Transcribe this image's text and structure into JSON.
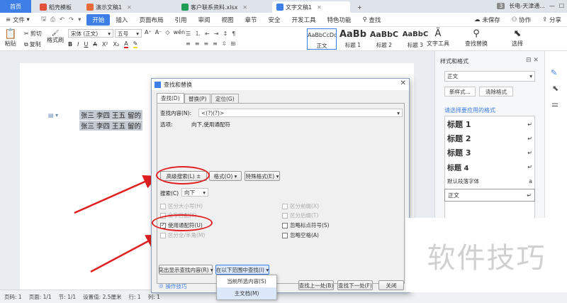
{
  "tabs": {
    "home": "首页",
    "items": [
      {
        "label": "稻壳模板",
        "color": "#e0533a"
      },
      {
        "label": "演示文稿1",
        "color": "#e86a3a"
      },
      {
        "label": "客户联系资料.xlsx",
        "color": "#1f9d55"
      },
      {
        "label": "文字文稿1",
        "color": "#3d7fe6"
      }
    ],
    "badge": "3",
    "user": "长电-天津通..."
  },
  "menu": {
    "file": "文件",
    "items": [
      "开始",
      "插入",
      "页面布局",
      "引用",
      "审阅",
      "视图",
      "章节",
      "安全",
      "开发工具",
      "特色功能"
    ],
    "search": "查找",
    "unsaved": "未保存",
    "collab": "协作",
    "share": "分享"
  },
  "ribbon": {
    "paste": "粘贴",
    "cut": "剪切",
    "copy": "复制",
    "format_painter": "格式刷",
    "font_name": "宋体 (正文)",
    "font_size": "五号",
    "styles": [
      {
        "preview": "AaBbCcDd",
        "label": "正文"
      },
      {
        "preview": "AaBb",
        "label": "标题 1"
      },
      {
        "preview": "AaBbC",
        "label": "标题 2"
      },
      {
        "preview": "AaBbC",
        "label": "标题 3"
      }
    ],
    "text_tools": "文字工具",
    "find_replace": "查找替换",
    "select": "选择"
  },
  "document": {
    "line1": "张三  李四  王五  留的",
    "line2": "张三  李四  王五  留的"
  },
  "panel": {
    "title": "样式和格式",
    "current_style": "正文",
    "new_style": "新样式...",
    "clear_format": "清除格式",
    "apply_label": "请选择要应用的格式",
    "styles": [
      "标题 1",
      "标题 2",
      "标题 3",
      "标题 4"
    ],
    "default_font": "默认段落字体",
    "body": "正文"
  },
  "status": {
    "page": "页码: 1",
    "pages": "页面: 1/1",
    "section": "节: 1/1",
    "setting": "设置值: 2.5厘米",
    "row": "行: 1",
    "col": "列: 1"
  },
  "dialog": {
    "title": "查找和替换",
    "tabs": [
      "查找(D)",
      "替换(P)",
      "定位(G)"
    ],
    "find_label": "查找内容(N):",
    "find_value": "<(?)(?)>",
    "options_label": "选项:",
    "options_value": "向下,使用通配符",
    "advanced": "高级搜索(L) ±",
    "format": "格式(O) ▾",
    "special": "特殊格式(E) ▾",
    "search_label": "搜索(C)",
    "search_value": "向下",
    "checkboxes_left": [
      {
        "label": "区分大小写(H)",
        "checked": false,
        "disabled": true
      },
      {
        "label": "全字匹配(Y)",
        "checked": false,
        "disabled": true
      },
      {
        "label": "使用通配符(U)",
        "checked": true,
        "disabled": false
      },
      {
        "label": "区分全/半角(M)",
        "checked": false,
        "disabled": true
      }
    ],
    "checkboxes_right": [
      {
        "label": "区分前缀(X)",
        "checked": false,
        "disabled": true
      },
      {
        "label": "区分后缀(T)",
        "checked": false,
        "disabled": true
      },
      {
        "label": "忽略标点符号(S)",
        "checked": false,
        "disabled": false
      },
      {
        "label": "忽略空格(A)",
        "checked": false,
        "disabled": false
      }
    ],
    "highlight": "突出显示查找内容(R) ▾",
    "find_in": "在以下范围中查找(I) ▾",
    "find_prev": "查找上一处(B)",
    "find_next": "查找下一处(F)",
    "close": "关闭",
    "tips": "操作技巧",
    "dropdown": [
      "当前所选内容(S)",
      "主文档(M)"
    ]
  },
  "watermark": "软件技巧"
}
